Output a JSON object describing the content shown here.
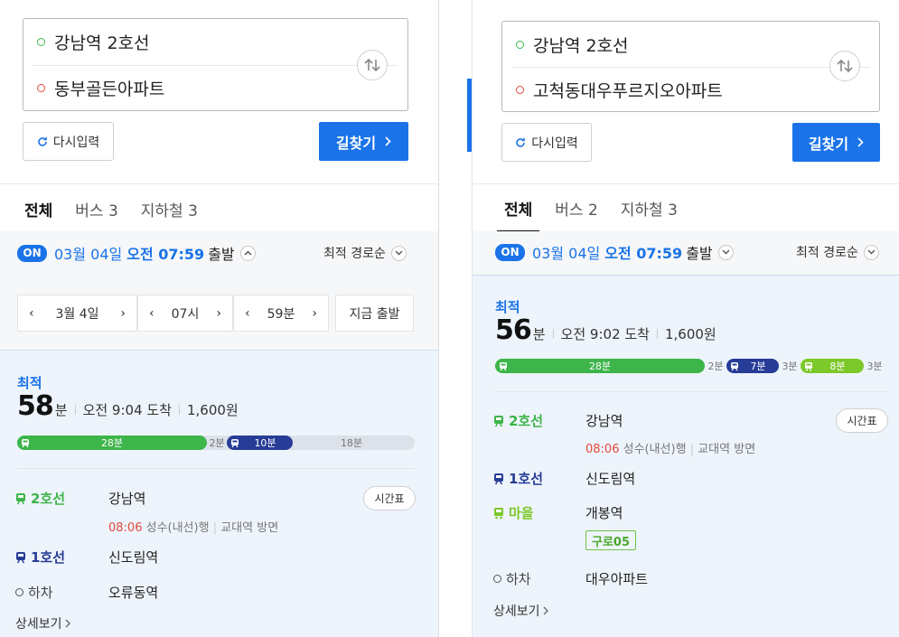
{
  "left": {
    "search": {
      "origin": "강남역 2호선",
      "destination": "동부골든아파트",
      "reset_label": "다시입력",
      "go_label": "길찾기"
    },
    "tabs": [
      "전체",
      "버스 3",
      "지하철 3"
    ],
    "depart": {
      "on_label": "ON",
      "date": "03월 04일",
      "time": "오전 07:59",
      "suffix": "출발",
      "sort_label": "최적 경로순"
    },
    "picker": {
      "day": "3월 4일",
      "hour": "07시",
      "minute": "59분",
      "now_label": "지금 출발"
    },
    "route": {
      "badge": "최적",
      "minutes": "58",
      "min_unit": "분",
      "arrive": "오전 9:04 도착",
      "fare": "1,600원",
      "bar": {
        "segments": [
          {
            "type": "subway2",
            "label": "28분",
            "color": "#3db54a"
          },
          {
            "type": "walk",
            "label": "2분"
          },
          {
            "type": "subway1",
            "label": "10분",
            "color": "#263c96"
          },
          {
            "type": "remaining",
            "label": "18분"
          }
        ]
      },
      "steps": [
        {
          "line": "2호선",
          "color": "#3db54a",
          "icon": "subway-icon",
          "station": "강남역",
          "time": "08:06",
          "desc": "성수(내선)행",
          "dir": "교대역 방면",
          "timetable": "시간표"
        },
        {
          "line": "1호선",
          "color": "#263c96",
          "icon": "subway-icon",
          "station": "신도림역"
        },
        {
          "line": "하차",
          "color": "#444444",
          "icon": "circle-icon",
          "station": "오류동역"
        }
      ],
      "more_label": "상세보기"
    }
  },
  "right": {
    "search": {
      "origin": "강남역 2호선",
      "destination": "고척동대우푸르지오아파트",
      "reset_label": "다시입력",
      "go_label": "길찾기"
    },
    "tabs": [
      "전체",
      "버스 2",
      "지하철 3"
    ],
    "depart": {
      "on_label": "ON",
      "date": "03월 04일",
      "time": "오전 07:59",
      "suffix": "출발",
      "sort_label": "최적 경로순"
    },
    "route": {
      "badge": "최적",
      "minutes": "56",
      "min_unit": "분",
      "arrive": "오전 9:02 도착",
      "fare": "1,600원",
      "bar": {
        "segments": [
          {
            "type": "subway2",
            "label": "28분",
            "color": "#3db54a"
          },
          {
            "type": "walk",
            "label": "2분"
          },
          {
            "type": "subway1",
            "label": "7분",
            "color": "#263c96"
          },
          {
            "type": "walk",
            "label": "3분"
          },
          {
            "type": "bus",
            "label": "8분",
            "color": "#7dc82a"
          },
          {
            "type": "walk",
            "label": "3분"
          }
        ]
      },
      "steps": [
        {
          "line": "2호선",
          "color": "#3db54a",
          "icon": "subway-icon",
          "station": "강남역",
          "time": "08:06",
          "desc": "성수(내선)행",
          "dir": "교대역 방면",
          "timetable": "시간표"
        },
        {
          "line": "1호선",
          "color": "#263c96",
          "icon": "subway-icon",
          "station": "신도림역"
        },
        {
          "line": "마을",
          "color": "#7dc82a",
          "icon": "bus-icon",
          "station": "개봉역",
          "bus_no": "구로05"
        },
        {
          "line": "하차",
          "color": "#444444",
          "icon": "circle-icon",
          "station": "대우아파트"
        }
      ],
      "more_label": "상세보기"
    }
  }
}
